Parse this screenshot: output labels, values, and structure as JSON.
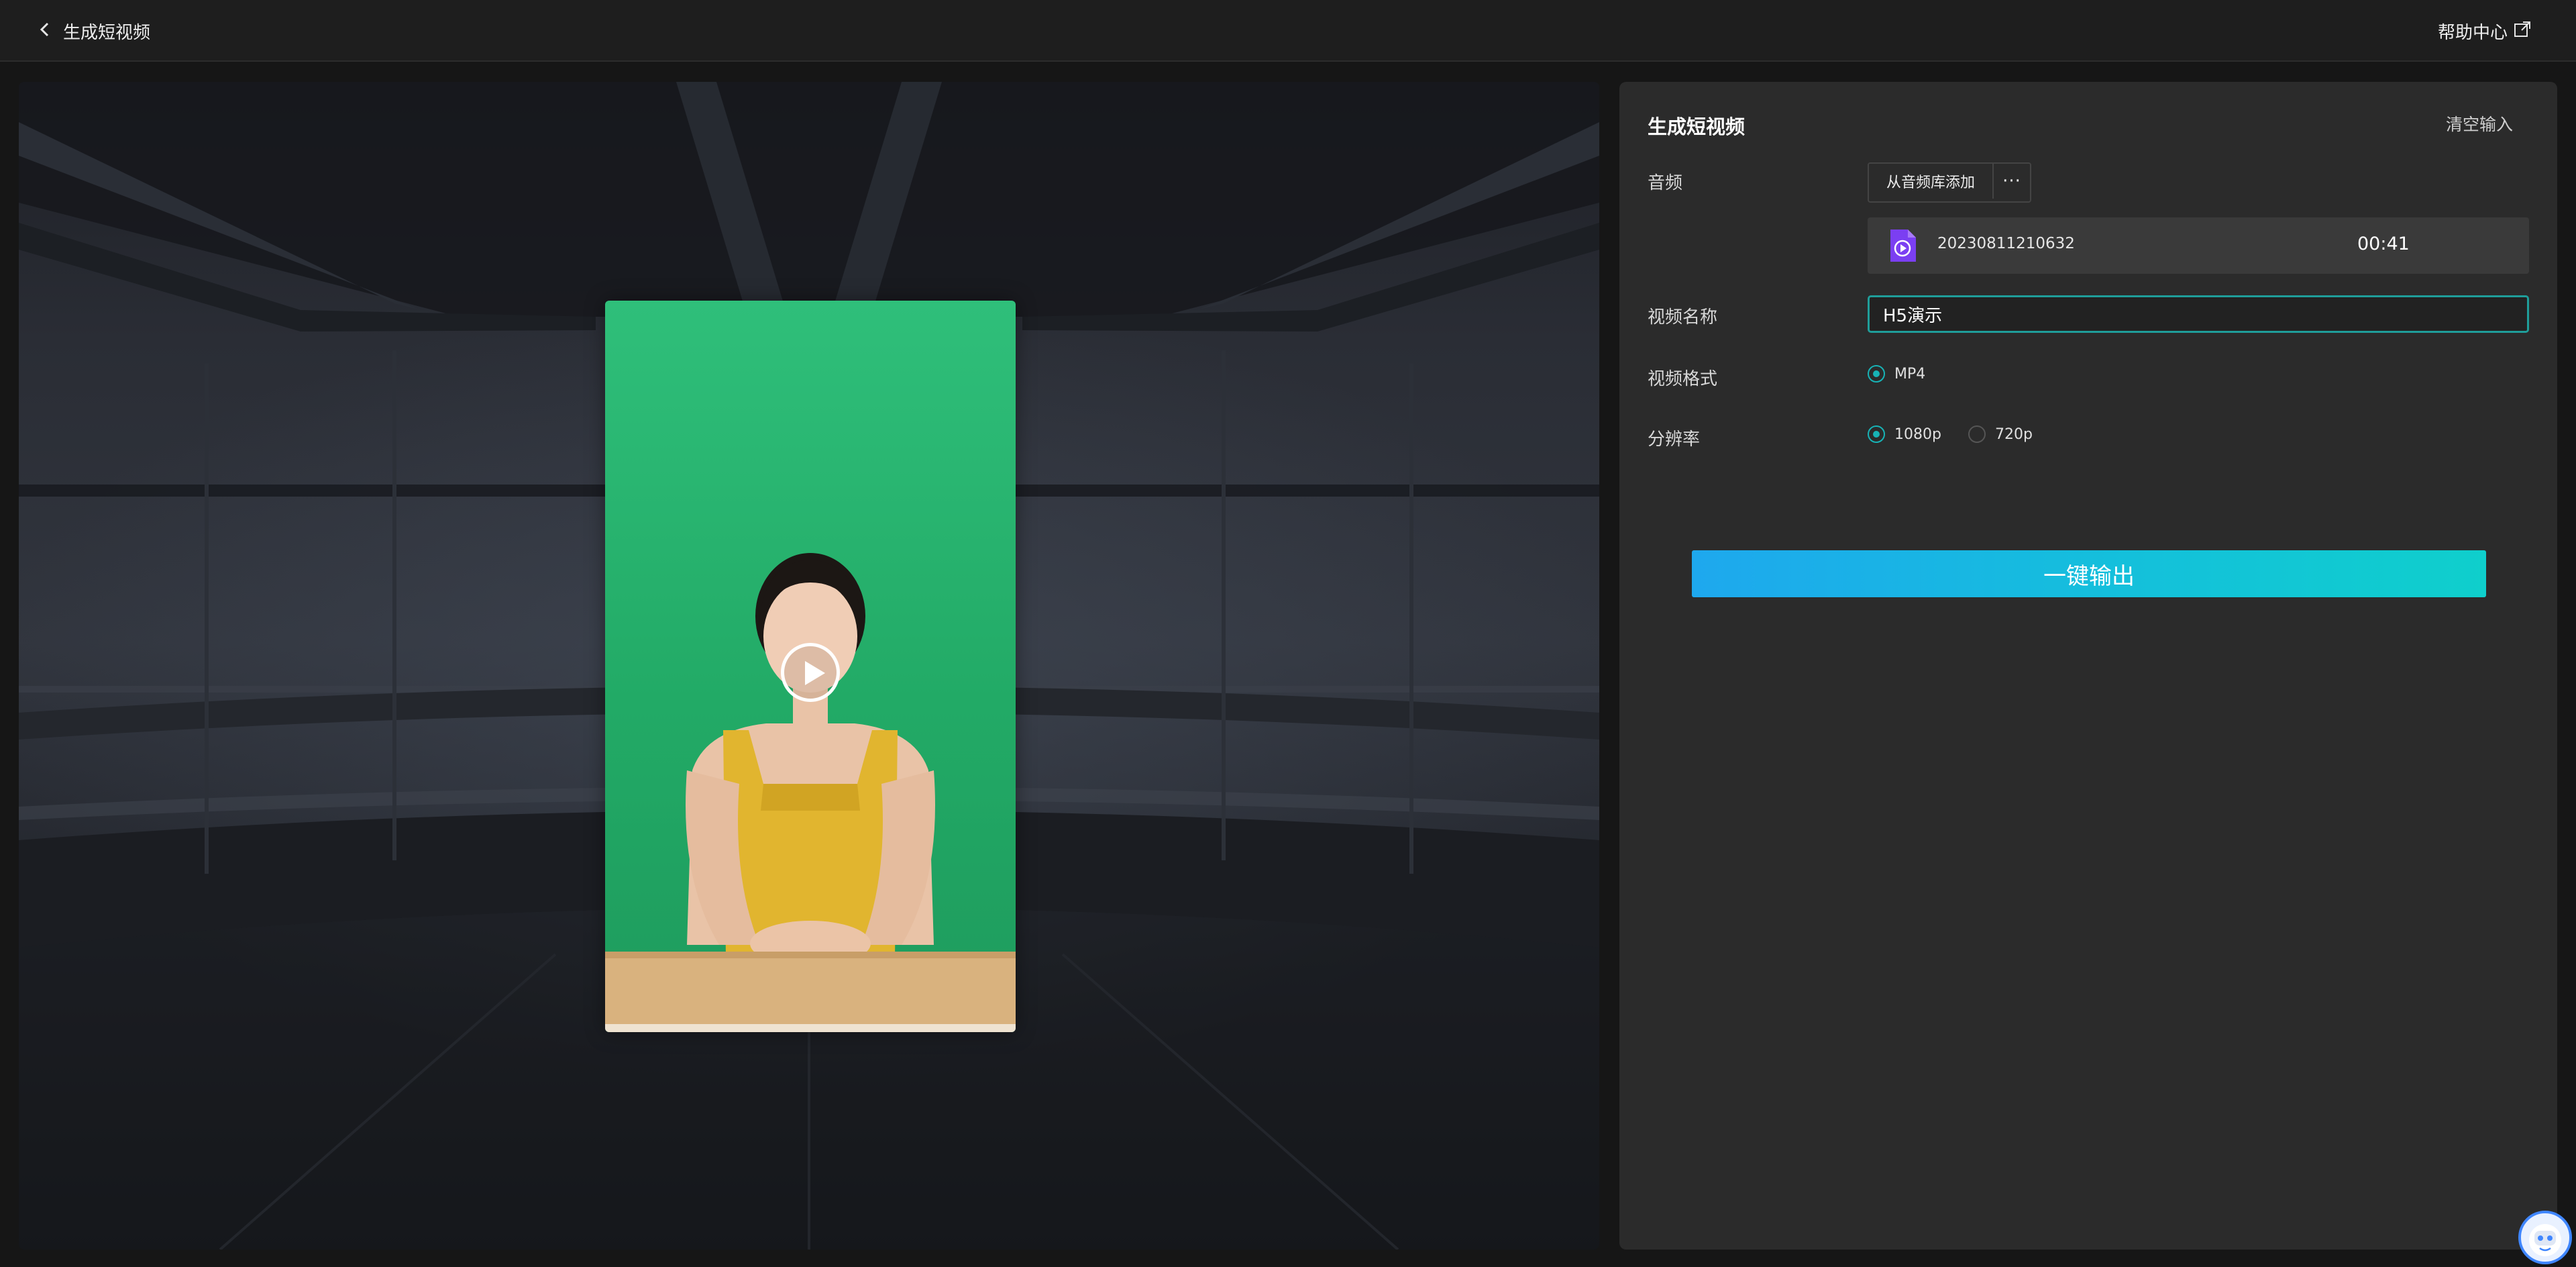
{
  "header": {
    "back_label": "生成短视频",
    "help_label": "帮助中心"
  },
  "panel": {
    "title": "生成短视频",
    "clear_label": "清空输入",
    "audio": {
      "label": "音频",
      "add_from_library": "从音频库添加",
      "more": "···",
      "file_name": "20230811210632",
      "duration": "00:41"
    },
    "video_name": {
      "label": "视频名称",
      "value": "H5演示"
    },
    "format": {
      "label": "视频格式",
      "options": [
        {
          "label": "MP4",
          "selected": true
        }
      ]
    },
    "resolution": {
      "label": "分辨率",
      "options": [
        {
          "label": "1080p",
          "selected": true
        },
        {
          "label": "720p",
          "selected": false
        }
      ]
    },
    "export_label": "一键输出"
  },
  "colors": {
    "accent": "#17b3b6",
    "export_gradient_start": "#1ea8ee",
    "export_gradient_end": "#0fcfcc",
    "audio_icon": "#7b3ff2",
    "greenscreen": "#2fbf7a"
  },
  "icons": {
    "back": "chevron-left-icon",
    "help_external": "external-link-icon",
    "audio_file": "audio-file-icon",
    "play": "play-icon",
    "assistant": "assistant-avatar-icon"
  }
}
